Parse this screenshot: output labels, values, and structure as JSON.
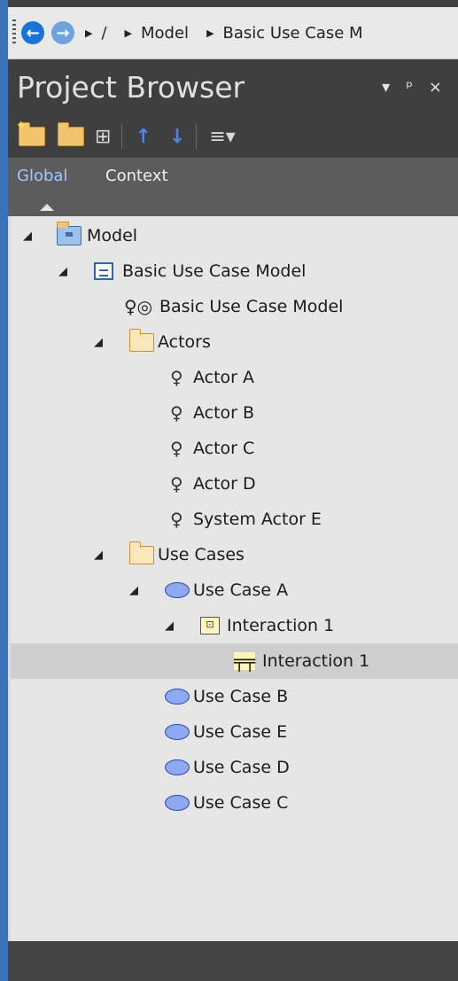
{
  "breadcrumb": {
    "root": "/",
    "items": [
      "Model",
      "Basic Use Case M"
    ]
  },
  "panel": {
    "title": "Project Browser",
    "controls": {
      "dropdown": "▾",
      "pin": "ᵖ",
      "close": "×"
    }
  },
  "toolbar": {
    "icons": [
      "new-package-icon",
      "package-icon",
      "diagram-icon",
      "move-up-icon",
      "move-down-icon",
      "menu-icon"
    ]
  },
  "tabs": {
    "global": "Global",
    "context": "Context"
  },
  "tree": [
    {
      "label": "Model",
      "icon": "model-package-icon",
      "level": 0,
      "expanded": true
    },
    {
      "label": "Basic Use Case Model",
      "icon": "use-case-model-icon",
      "level": 1,
      "expanded": true
    },
    {
      "label": "Basic Use Case Model",
      "icon": "use-case-diagram-icon",
      "level": 2
    },
    {
      "label": "Actors",
      "icon": "folder-icon",
      "level": 2,
      "expanded": true
    },
    {
      "label": "Actor A",
      "icon": "actor-icon",
      "level": 3
    },
    {
      "label": "Actor B",
      "icon": "actor-icon",
      "level": 3
    },
    {
      "label": "Actor C",
      "icon": "actor-icon",
      "level": 3
    },
    {
      "label": "Actor D",
      "icon": "actor-icon",
      "level": 3
    },
    {
      "label": "System Actor E",
      "icon": "actor-icon",
      "level": 3
    },
    {
      "label": "Use Cases",
      "icon": "folder-icon",
      "level": 2,
      "expanded": true
    },
    {
      "label": "Use Case A",
      "icon": "use-case-icon",
      "level": 3,
      "expanded": true
    },
    {
      "label": "Interaction 1",
      "icon": "interaction-icon",
      "level": 4,
      "expanded": true
    },
    {
      "label": "Interaction 1",
      "icon": "sequence-diagram-icon",
      "level": 5,
      "selected": true
    },
    {
      "label": "Use Case B",
      "icon": "use-case-icon",
      "level": 3
    },
    {
      "label": "Use Case E",
      "icon": "use-case-icon",
      "level": 3
    },
    {
      "label": "Use Case D",
      "icon": "use-case-icon",
      "level": 3
    },
    {
      "label": "Use Case C",
      "icon": "use-case-icon",
      "level": 3
    }
  ],
  "colors": {
    "accent": "#3b73b8",
    "selected_row": "#cfcfcf",
    "tree_bg": "#e6e6e6"
  }
}
